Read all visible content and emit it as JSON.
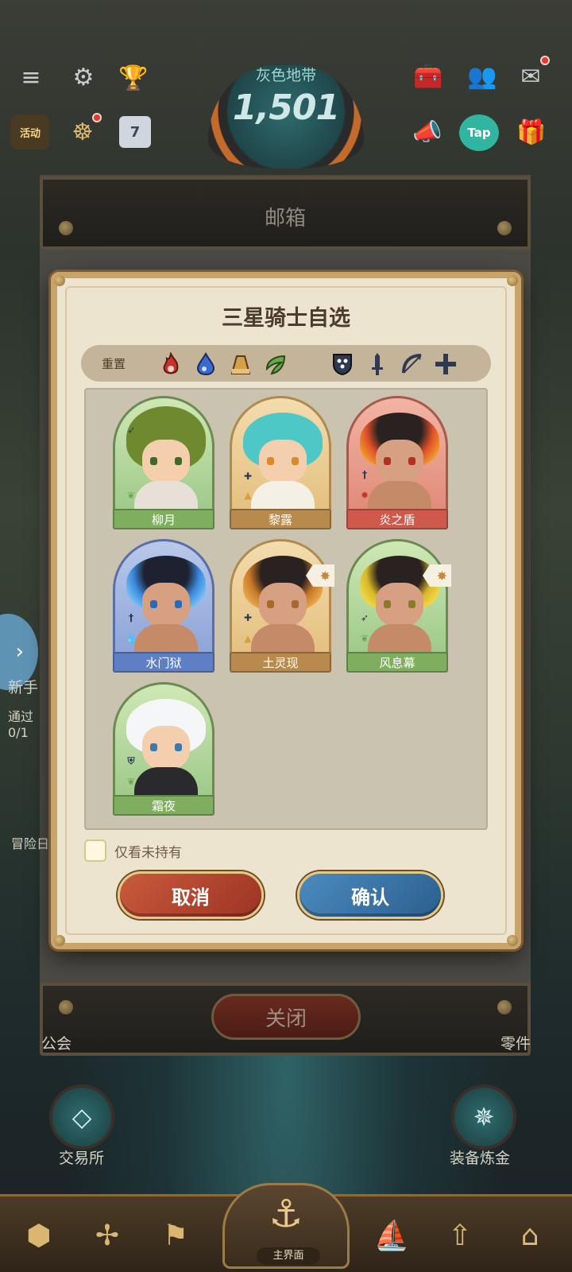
{
  "topbar": {
    "zone_title": "灰色地带",
    "zone_score": "1,501",
    "activity_label": "活动",
    "calendar_day": "7",
    "tap_label": "Tap"
  },
  "mailbox": {
    "title": "邮箱",
    "close_label": "关闭"
  },
  "modal": {
    "title": "三星骑士自选",
    "filter": {
      "reset_label": "重置",
      "element_icons": [
        "fire-icon",
        "water-icon",
        "earth-icon",
        "wind-icon"
      ],
      "class_icons": [
        "shield-icon",
        "sword-icon",
        "bow-icon",
        "cross-icon"
      ]
    },
    "knights": [
      {
        "name": "柳月",
        "element": "wind"
      },
      {
        "name": "黎露",
        "element": "earth"
      },
      {
        "name": "炎之盾",
        "element": "fire"
      },
      {
        "name": "水门狱",
        "element": "water"
      },
      {
        "name": "土灵现",
        "element": "earth"
      },
      {
        "name": "风息幕",
        "element": "wind"
      },
      {
        "name": "霜夜",
        "element": "wind"
      }
    ],
    "only_unowned_label": "仅看未持有",
    "only_unowned_checked": false,
    "cancel_label": "取消",
    "confirm_label": "确认"
  },
  "background": {
    "left_labels": [
      "新手",
      "通过",
      "0/1",
      "冒险日"
    ],
    "guild_label": "公会",
    "parts_label": "零件",
    "exchange_label": "交易所",
    "refine_label": "装备炼金",
    "main_label": "主界面"
  },
  "colors": {
    "wind": "#7fae5e",
    "earth": "#b98a4e",
    "fire": "#cf5a4c",
    "water": "#5f7fc4"
  }
}
